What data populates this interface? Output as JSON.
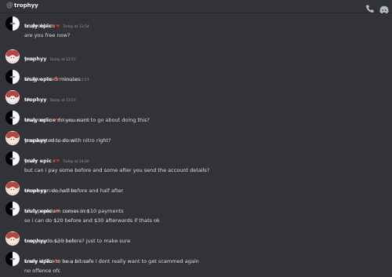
{
  "header": {
    "at_symbol": "@",
    "title": "trophyy",
    "call_icon": "phone-call-icon",
    "app_icon": "discord-icon"
  },
  "users": {
    "epic": "truly epic",
    "trophyy": "trophyy"
  },
  "colors": {
    "background": "#313338",
    "text": "#dbdee1",
    "username": "#f2f3f5",
    "timestamp": "#949ba4"
  },
  "messages": [
    {
      "author": "truly epic",
      "time": "Today at 13:54",
      "lines": [
        "no problem",
        "are you free now?"
      ]
    },
    {
      "author": "trophyy",
      "time": "Today at 13:57",
      "lines": [
        "yes"
      ]
    },
    {
      "author": "truly epic",
      "time": "Today at 13:57",
      "lines": [
        "alr give me 5 minutes"
      ]
    },
    {
      "author": "trophyy",
      "time": "Today at 13:57",
      "lines": [
        "ok"
      ]
    },
    {
      "author": "truly epic",
      "time": "Today at 13:59",
      "lines": [
        "okay so how do you want to go about doing this?"
      ]
    },
    {
      "author": "trophyy",
      "time": "Today at 14:00",
      "lines": [
        "you wanted to do with nitro right?"
      ]
    },
    {
      "author": "truly epic",
      "time": "Today at 14:00",
      "lines": [
        "yeah",
        "but can i pay some before and some after you send the account details?"
      ]
    },
    {
      "author": "trophyy",
      "time": "Today at 14:01",
      "lines": [
        "ok we can do half before and half after"
      ]
    },
    {
      "author": "truly epic",
      "time": "Today at 14:01",
      "lines": [
        "nitro premium comes in $10 payments",
        "so i can do $20 before and $30 afterwards if thats ok"
      ]
    },
    {
      "author": "trophyy",
      "time": "Today at 14:01",
      "lines": [
        "can you do $30 before? just to make sure"
      ]
    },
    {
      "author": "truly epic",
      "time": "Today at 14:02",
      "lines": [
        "sorry id like to be a bit safe i dont really want to get scammed again",
        "no offence ofc"
      ]
    }
  ]
}
